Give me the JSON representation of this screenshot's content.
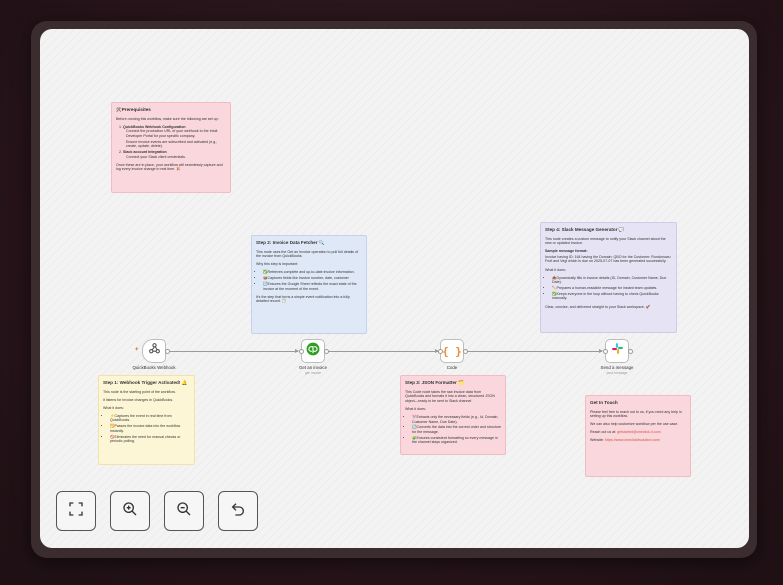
{
  "notes": {
    "prereq": {
      "title": "⚒️Prerequisites",
      "intro": "Before running this workflow, make sure the following are set up:",
      "item1_title": "QuickBooks Webhook Configuration",
      "item1_a": "Connect the production URL of your webhook to the Intuit Developer Portal for your specific company.",
      "item1_b": "Ensure invoice events are subscribed and activated (e.g., create, update, delete).",
      "item2_title": "Slack account Integration",
      "item2_a": "Connect your Slack client credentials.",
      "outro": "Once these are in place, your workflow will seamlessly capture and log every invoice change in real time. 🎉"
    },
    "step1": {
      "title": "Step 1: Webhook Trigger Activated! 🔔",
      "p1": "This node is the starting point of the workflow.",
      "p2": "It listens for invoice changes in QuickBooks.",
      "whatlabel": "What it does:",
      "b1": "⚡Captures the event in real time from QuickBooks.",
      "b2": "🔁Passes the invoice data into the workflow instantly.",
      "b3": "🚫Eliminates the need for manual checks or periodic polling."
    },
    "step2": {
      "title": "Step 2: Invoice Data Fetcher 🔍",
      "p1": "This node uses the Get an Invoice operation to pull full details of the invoice from QuickBooks.",
      "whylabel": "Why this step is important:",
      "b1": "✅Retrieves complete and up-to-date invoice information.",
      "b2": "📦Captures fields like invoice number, date, customer",
      "b3": "🔄Ensures the Google Sheet reflects the exact state of the invoice at the moment of the event.",
      "p2": "It's the step that turns a simple event notification into a fully detailed record. 📋"
    },
    "step3": {
      "title": "Step 3: JSON Formatter 🗂️",
      "p1": "This Code node takes the raw invoice data from QuickBooks and formats it into a clean, structured JSON object—ready to be sent to Slack channel",
      "whatlabel": "What it does:",
      "b1": "✂️Extracts only the necessary fields (e.g., Id, Domain, Customer Name, Due Date).",
      "b2": "🔄Converts the data into the correct order and structure for the message.",
      "b3": "🧩Ensures consistent formatting so every message in the channel stays organized."
    },
    "step4": {
      "title": "Step 4: Slack Message Generator 💬",
      "p1": "This node creates a custom message to notify your Slack channel about the new or updated invoice.",
      "samplelabel": "Sample message format:",
      "sample": "Invoice having ID: 164 having the Domain: QBO for the Customer: Rondonuwu Fruit and Vegi which is due on 2025-07-07 has been generated successfully.",
      "whatlabel": "What it does:",
      "b1": "📥Dynamically fills in invoice details (ID, Domain, Customer Name, Due Date).",
      "b2": "✏️Prepares a human-readable message for instant team updates.",
      "b3": "✅Keeps everyone in the loop without having to check QuickBooks manually.",
      "p2": "Clear, concise, and delivered straight to your Slack workspace. 🚀"
    },
    "contact": {
      "title": "Get In Touch",
      "p1": "Please feel free to reach out to us, if you need any help in setting up this workflow.",
      "p2": "We can also help customize workflow per the use case.",
      "email_label": "Reach out us at:",
      "email": "getstarted@oneclick-it.com",
      "website_label": "Website:",
      "website": "https://www.oneclickitsolution.com/"
    }
  },
  "nodes": {
    "webhook": {
      "label": "QuickBooks Webhook",
      "icon": "webhook-icon"
    },
    "invoice": {
      "label": "Get an invoice",
      "sublabel": "get: invoice",
      "icon": "quickbooks-icon"
    },
    "code": {
      "label": "Code",
      "icon": "code-braces-icon"
    },
    "slack": {
      "label": "Send a message",
      "sublabel": "post: message",
      "icon": "slack-icon"
    }
  },
  "controls": {
    "fit": "fit-view-icon",
    "zoom_in": "zoom-in-icon",
    "zoom_out": "zoom-out-icon",
    "undo": "undo-icon"
  },
  "colors": {
    "accent": "#e0582f",
    "note_pink": "#f9d7dc",
    "note_blue": "#dfe8f6",
    "note_yellow": "#fdf6d6",
    "note_purple": "#e6e3f4"
  }
}
